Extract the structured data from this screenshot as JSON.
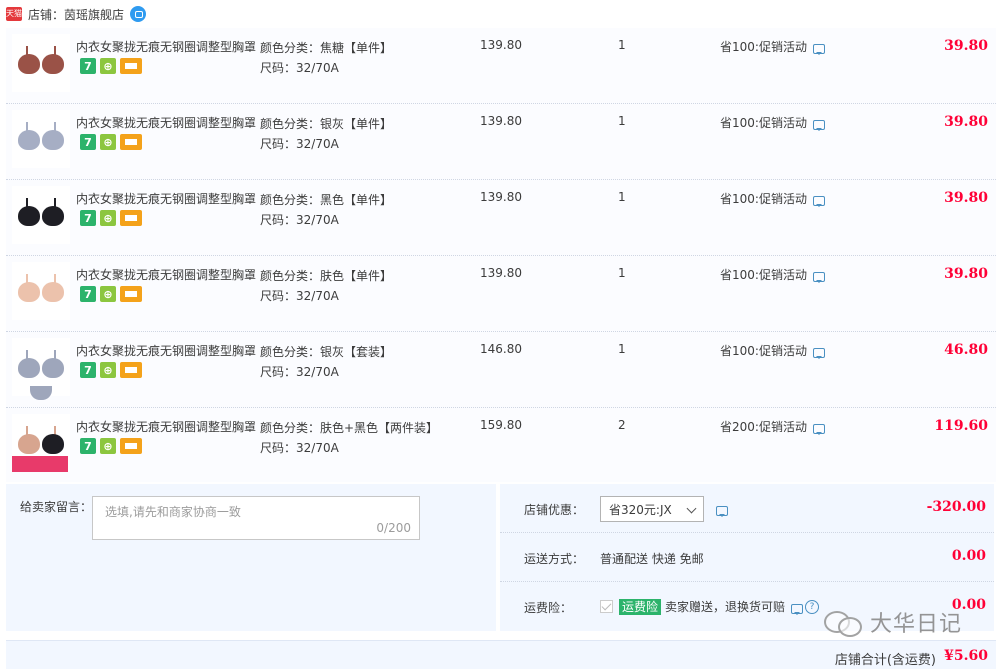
{
  "shop": {
    "badge": "天猫",
    "name": "店铺：茵瑶旗舰店"
  },
  "items": [
    {
      "title": "内衣女聚拢无痕无钢圈调整型胸罩",
      "color": "颜色分类：焦糖【单件】",
      "size": "尺码：32/70A",
      "price": "139.80",
      "qty": "1",
      "promo": "省100:促销活动",
      "subtotal": "39.80",
      "tone": "#9a5247"
    },
    {
      "title": "内衣女聚拢无痕无钢圈调整型胸罩",
      "color": "颜色分类：银灰【单件】",
      "size": "尺码：32/70A",
      "price": "139.80",
      "qty": "1",
      "promo": "省100:促销活动",
      "subtotal": "39.80",
      "tone": "#a6aec4"
    },
    {
      "title": "内衣女聚拢无痕无钢圈调整型胸罩",
      "color": "颜色分类：黑色【单件】",
      "size": "尺码：32/70A",
      "price": "139.80",
      "qty": "1",
      "promo": "省100:促销活动",
      "subtotal": "39.80",
      "tone": "#1e1e24"
    },
    {
      "title": "内衣女聚拢无痕无钢圈调整型胸罩",
      "color": "颜色分类：肤色【单件】",
      "size": "尺码：32/70A",
      "price": "139.80",
      "qty": "1",
      "promo": "省100:促销活动",
      "subtotal": "39.80",
      "tone": "#ecc2ac"
    },
    {
      "title": "内衣女聚拢无痕无钢圈调整型胸罩",
      "color": "颜色分类：银灰【套装】",
      "size": "尺码：32/70A",
      "price": "146.80",
      "qty": "1",
      "promo": "省100:促销活动",
      "subtotal": "46.80",
      "tone": "#9ea6bb"
    },
    {
      "title": "内衣女聚拢无痕无钢圈调整型胸罩",
      "color": "颜色分类：肤色+黑色【两件装】",
      "size": "尺码：32/70A",
      "price": "159.80",
      "qty": "2",
      "promo": "省200:促销活动",
      "subtotal": "119.60",
      "tone": "#d7a58f"
    }
  ],
  "memo": {
    "label": "给卖家留言：",
    "placeholder": "选填,请先和商家协商一致",
    "count": "0/200"
  },
  "discount": {
    "label": "店铺优惠：",
    "selected": "省320元:JX",
    "value": "-320.00"
  },
  "shipping": {
    "label": "运送方式：",
    "method": "普通配送 快递 免邮",
    "value": "0.00"
  },
  "insurance": {
    "label": "运费险：",
    "tag": "运费险",
    "text": "卖家赠送，退换货可赔",
    "value": "0.00"
  },
  "total": {
    "label": "店铺合计(含运费)",
    "value": "¥5.60"
  },
  "watermark": {
    "text": "大华日记"
  }
}
